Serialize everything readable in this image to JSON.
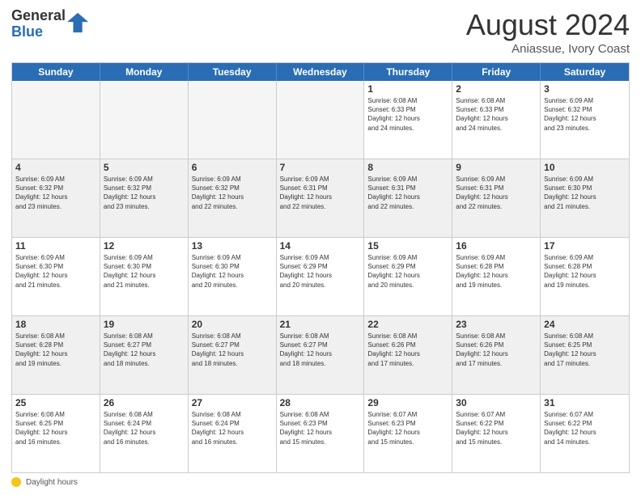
{
  "logo": {
    "general": "General",
    "blue": "Blue"
  },
  "title": "August 2024",
  "location": "Aniassue, Ivory Coast",
  "days_header": [
    "Sunday",
    "Monday",
    "Tuesday",
    "Wednesday",
    "Thursday",
    "Friday",
    "Saturday"
  ],
  "weeks": [
    [
      {
        "day": "",
        "info": "",
        "empty": true
      },
      {
        "day": "",
        "info": "",
        "empty": true
      },
      {
        "day": "",
        "info": "",
        "empty": true
      },
      {
        "day": "",
        "info": "",
        "empty": true
      },
      {
        "day": "1",
        "info": "Sunrise: 6:08 AM\nSunset: 6:33 PM\nDaylight: 12 hours\nand 24 minutes."
      },
      {
        "day": "2",
        "info": "Sunrise: 6:08 AM\nSunset: 6:33 PM\nDaylight: 12 hours\nand 24 minutes."
      },
      {
        "day": "3",
        "info": "Sunrise: 6:09 AM\nSunset: 6:32 PM\nDaylight: 12 hours\nand 23 minutes."
      }
    ],
    [
      {
        "day": "4",
        "info": "Sunrise: 6:09 AM\nSunset: 6:32 PM\nDaylight: 12 hours\nand 23 minutes.",
        "shaded": true
      },
      {
        "day": "5",
        "info": "Sunrise: 6:09 AM\nSunset: 6:32 PM\nDaylight: 12 hours\nand 23 minutes.",
        "shaded": true
      },
      {
        "day": "6",
        "info": "Sunrise: 6:09 AM\nSunset: 6:32 PM\nDaylight: 12 hours\nand 22 minutes.",
        "shaded": true
      },
      {
        "day": "7",
        "info": "Sunrise: 6:09 AM\nSunset: 6:31 PM\nDaylight: 12 hours\nand 22 minutes.",
        "shaded": true
      },
      {
        "day": "8",
        "info": "Sunrise: 6:09 AM\nSunset: 6:31 PM\nDaylight: 12 hours\nand 22 minutes.",
        "shaded": true
      },
      {
        "day": "9",
        "info": "Sunrise: 6:09 AM\nSunset: 6:31 PM\nDaylight: 12 hours\nand 22 minutes.",
        "shaded": true
      },
      {
        "day": "10",
        "info": "Sunrise: 6:09 AM\nSunset: 6:30 PM\nDaylight: 12 hours\nand 21 minutes.",
        "shaded": true
      }
    ],
    [
      {
        "day": "11",
        "info": "Sunrise: 6:09 AM\nSunset: 6:30 PM\nDaylight: 12 hours\nand 21 minutes."
      },
      {
        "day": "12",
        "info": "Sunrise: 6:09 AM\nSunset: 6:30 PM\nDaylight: 12 hours\nand 21 minutes."
      },
      {
        "day": "13",
        "info": "Sunrise: 6:09 AM\nSunset: 6:30 PM\nDaylight: 12 hours\nand 20 minutes."
      },
      {
        "day": "14",
        "info": "Sunrise: 6:09 AM\nSunset: 6:29 PM\nDaylight: 12 hours\nand 20 minutes."
      },
      {
        "day": "15",
        "info": "Sunrise: 6:09 AM\nSunset: 6:29 PM\nDaylight: 12 hours\nand 20 minutes."
      },
      {
        "day": "16",
        "info": "Sunrise: 6:09 AM\nSunset: 6:28 PM\nDaylight: 12 hours\nand 19 minutes."
      },
      {
        "day": "17",
        "info": "Sunrise: 6:09 AM\nSunset: 6:28 PM\nDaylight: 12 hours\nand 19 minutes."
      }
    ],
    [
      {
        "day": "18",
        "info": "Sunrise: 6:08 AM\nSunset: 6:28 PM\nDaylight: 12 hours\nand 19 minutes.",
        "shaded": true
      },
      {
        "day": "19",
        "info": "Sunrise: 6:08 AM\nSunset: 6:27 PM\nDaylight: 12 hours\nand 18 minutes.",
        "shaded": true
      },
      {
        "day": "20",
        "info": "Sunrise: 6:08 AM\nSunset: 6:27 PM\nDaylight: 12 hours\nand 18 minutes.",
        "shaded": true
      },
      {
        "day": "21",
        "info": "Sunrise: 6:08 AM\nSunset: 6:27 PM\nDaylight: 12 hours\nand 18 minutes.",
        "shaded": true
      },
      {
        "day": "22",
        "info": "Sunrise: 6:08 AM\nSunset: 6:26 PM\nDaylight: 12 hours\nand 17 minutes.",
        "shaded": true
      },
      {
        "day": "23",
        "info": "Sunrise: 6:08 AM\nSunset: 6:26 PM\nDaylight: 12 hours\nand 17 minutes.",
        "shaded": true
      },
      {
        "day": "24",
        "info": "Sunrise: 6:08 AM\nSunset: 6:25 PM\nDaylight: 12 hours\nand 17 minutes.",
        "shaded": true
      }
    ],
    [
      {
        "day": "25",
        "info": "Sunrise: 6:08 AM\nSunset: 6:25 PM\nDaylight: 12 hours\nand 16 minutes."
      },
      {
        "day": "26",
        "info": "Sunrise: 6:08 AM\nSunset: 6:24 PM\nDaylight: 12 hours\nand 16 minutes."
      },
      {
        "day": "27",
        "info": "Sunrise: 6:08 AM\nSunset: 6:24 PM\nDaylight: 12 hours\nand 16 minutes."
      },
      {
        "day": "28",
        "info": "Sunrise: 6:08 AM\nSunset: 6:23 PM\nDaylight: 12 hours\nand 15 minutes."
      },
      {
        "day": "29",
        "info": "Sunrise: 6:07 AM\nSunset: 6:23 PM\nDaylight: 12 hours\nand 15 minutes."
      },
      {
        "day": "30",
        "info": "Sunrise: 6:07 AM\nSunset: 6:22 PM\nDaylight: 12 hours\nand 15 minutes."
      },
      {
        "day": "31",
        "info": "Sunrise: 6:07 AM\nSunset: 6:22 PM\nDaylight: 12 hours\nand 14 minutes."
      }
    ]
  ],
  "footer": {
    "icon_label": "sun-icon",
    "text": "Daylight hours"
  }
}
